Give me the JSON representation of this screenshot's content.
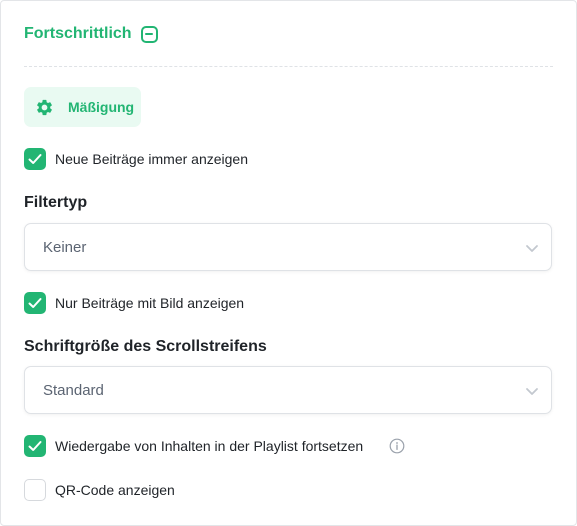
{
  "section": {
    "title": "Fortschrittlich"
  },
  "moderation": {
    "label": "Mäßigung",
    "icon": "gear-icon"
  },
  "options": {
    "show_new_posts": {
      "label": "Neue Beiträge immer anzeigen",
      "checked": true
    },
    "image_posts_only": {
      "label": "Nur Beiträge mit Bild anzeigen",
      "checked": true
    },
    "continue_playlist": {
      "label": "Wiedergabe von Inhalten in der Playlist fortsetzen",
      "checked": true
    },
    "show_qr_code": {
      "label": "QR-Code anzeigen",
      "checked": false
    }
  },
  "filter_type": {
    "label": "Filtertyp",
    "value": "Keiner"
  },
  "ticker_font_size": {
    "label": "Schriftgröße des Scrollstreifens",
    "value": "Standard"
  },
  "colors": {
    "accent": "#22b573",
    "accent_bg": "#e9faf2",
    "border": "#dfe2e6"
  }
}
